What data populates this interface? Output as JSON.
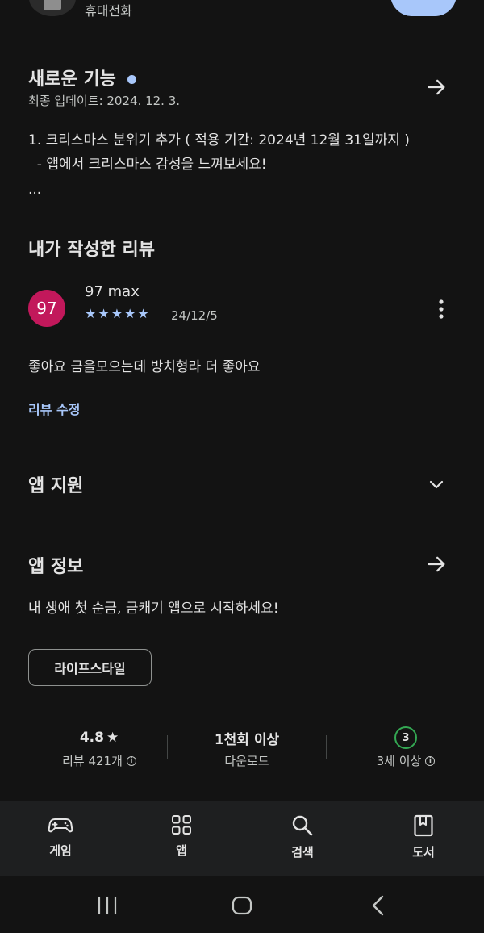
{
  "top": {
    "device_label": "휴대전화"
  },
  "whats_new": {
    "title": "새로운 기능",
    "updated": "최종 업데이트: 2024. 12. 3.",
    "lines": [
      "1. 크리스마스 분위기 추가 ( 적용 기간: 2024년 12월 31일까지 )",
      "  - 앱에서 크리스마스 감성을 느껴보세요!",
      "..."
    ]
  },
  "my_review": {
    "title": "내가 작성한 리뷰",
    "avatar_text": "97",
    "user_name": "97 max",
    "stars": 5,
    "date": "24/12/5",
    "text": "좋아요 금을모으는데 방치형라 더 좋아요",
    "edit_label": "리뷰 수정"
  },
  "app_support": {
    "title": "앱 지원"
  },
  "app_info": {
    "title": "앱 정보",
    "description": "내 생애 첫 순금, 금캐기 앱으로 시작하세요!",
    "category_chip": "라이프스타일"
  },
  "stats": {
    "rating": "4.8",
    "rating_star": "★",
    "reviews": "리뷰 421개",
    "downloads": "1천회 이상",
    "downloads_label": "다운로드",
    "age_badge": "3",
    "age_label": "3세 이상"
  },
  "bottom_nav": {
    "items": [
      {
        "label": "게임",
        "icon": "gamepad-icon"
      },
      {
        "label": "앱",
        "icon": "apps-grid-icon"
      },
      {
        "label": "검색",
        "icon": "search-icon"
      },
      {
        "label": "도서",
        "icon": "book-icon"
      }
    ]
  },
  "colors": {
    "background": "#131313",
    "accent": "#a8c7fa",
    "avatar": "#c2185b",
    "age_badge_ring": "#34a853",
    "nav_background": "#1e1f20"
  }
}
